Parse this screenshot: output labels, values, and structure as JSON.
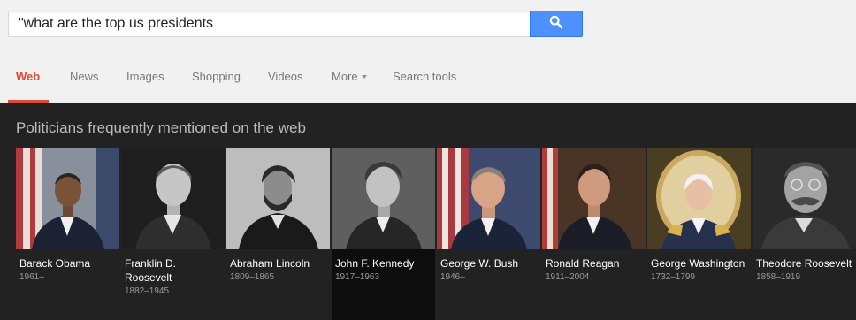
{
  "search": {
    "query": "\"what are the top us presidents"
  },
  "tabs": [
    {
      "label": "Web",
      "active": true
    },
    {
      "label": "News"
    },
    {
      "label": "Images"
    },
    {
      "label": "Shopping"
    },
    {
      "label": "Videos"
    },
    {
      "label": "More"
    },
    {
      "label": "Search tools"
    }
  ],
  "panel": {
    "title": "Politicians frequently mentioned on the web"
  },
  "people": [
    {
      "name": "Barack Obama",
      "years": "1961–"
    },
    {
      "name": "Franklin D. Roosevelt",
      "years": "1882–1945"
    },
    {
      "name": "Abraham Lincoln",
      "years": "1809–1865"
    },
    {
      "name": "John F. Kennedy",
      "years": "1917–1963"
    },
    {
      "name": "George W. Bush",
      "years": "1946–"
    },
    {
      "name": "Ronald Reagan",
      "years": "1911–2004"
    },
    {
      "name": "George Washington",
      "years": "1732–1799"
    },
    {
      "name": "Theodore Roosevelt",
      "years": "1858–1919"
    }
  ],
  "colors": {
    "accent": "#dd4b39",
    "search_button": "#4d90fe",
    "panel_bg": "#222222"
  }
}
